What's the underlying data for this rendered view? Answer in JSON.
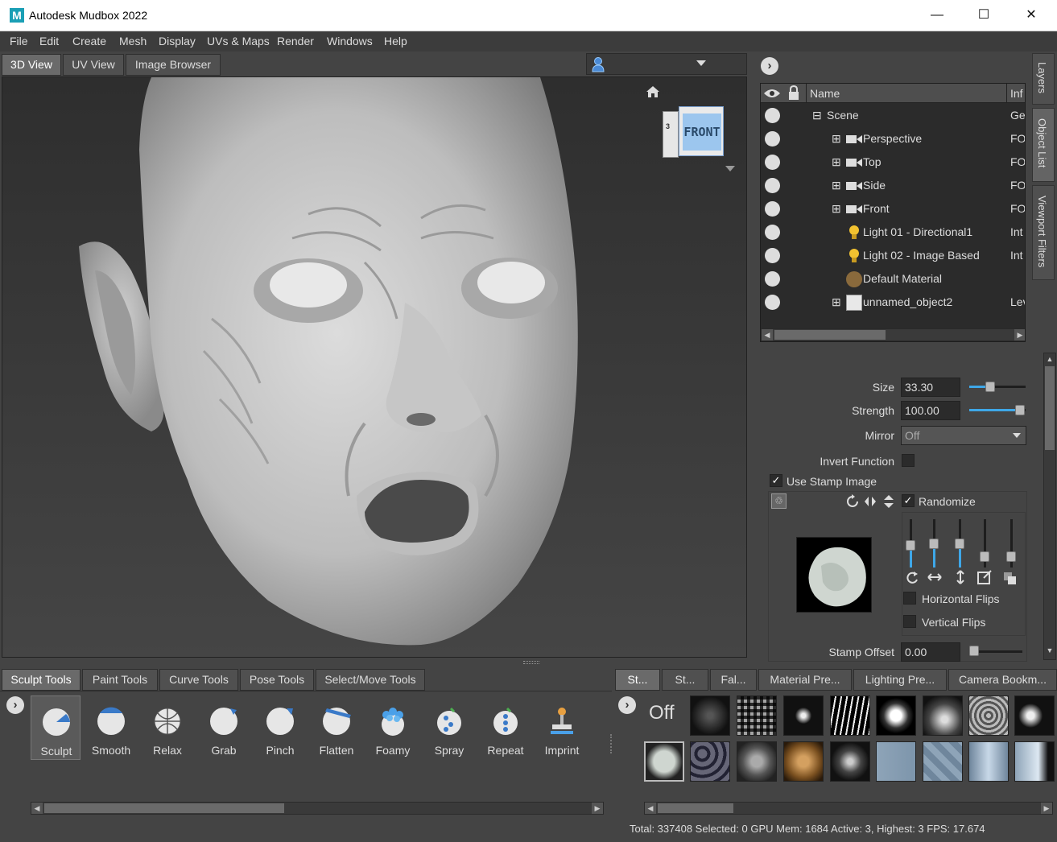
{
  "window": {
    "title": "Autodesk Mudbox 2022",
    "logo_letter": "M",
    "minimize": "—",
    "maximize": "☐",
    "close": "✕"
  },
  "menu": [
    "File",
    "Edit",
    "Create",
    "Mesh",
    "Display",
    "UVs & Maps",
    "Render",
    "Windows",
    "Help"
  ],
  "view_tabs": [
    {
      "label": "3D View",
      "active": true
    },
    {
      "label": "UV View",
      "active": false
    },
    {
      "label": "Image Browser",
      "active": false
    }
  ],
  "viewcube": {
    "face_label": "FRONT",
    "side_label": "3"
  },
  "object_list": {
    "columns": {
      "name": "Name",
      "info": "Inf"
    },
    "rows": [
      {
        "name": "Scene",
        "info": "Ge",
        "icon": "scene-node-icon",
        "expander": "⊟"
      },
      {
        "name": "Perspective",
        "info": "FO",
        "icon": "camera-icon",
        "expander": "⊞"
      },
      {
        "name": "Top",
        "info": "FO",
        "icon": "camera-icon",
        "expander": "⊞"
      },
      {
        "name": "Side",
        "info": "FO",
        "icon": "camera-icon",
        "expander": "⊞"
      },
      {
        "name": "Front",
        "info": "FO",
        "icon": "camera-icon",
        "expander": "⊞"
      },
      {
        "name": "Light 01 - Directional1",
        "info": "Int",
        "icon": "light-bulb-icon",
        "expander": ""
      },
      {
        "name": "Light 02 - Image Based",
        "info": "Int",
        "icon": "light-bulb-icon",
        "expander": ""
      },
      {
        "name": "Default Material",
        "info": "",
        "icon": "material-sphere-icon",
        "expander": ""
      },
      {
        "name": "unnamed_object2",
        "info": "Lev",
        "icon": "mesh-cube-icon",
        "expander": "⊞"
      }
    ]
  },
  "side_tabs": [
    "Layers",
    "Object List",
    "Viewport Filters"
  ],
  "properties": {
    "size_label": "Size",
    "size_value": "33.30",
    "size_fraction": 0.33,
    "strength_label": "Strength",
    "strength_value": "100.00",
    "strength_fraction": 1.0,
    "mirror_label": "Mirror",
    "mirror_value": "Off",
    "invert_label": "Invert Function",
    "invert_checked": false,
    "use_stamp_label": "Use Stamp Image",
    "use_stamp_checked": true,
    "randomize_label": "Randomize",
    "randomize_checked": true,
    "horizontal_flips_label": "Horizontal Flips",
    "horizontal_flips_checked": false,
    "vertical_flips_label": "Vertical Flips",
    "vertical_flips_checked": false,
    "stamp_offset_label": "Stamp Offset",
    "stamp_offset_value": "0.00"
  },
  "tool_tabs": [
    {
      "label": "Sculpt Tools",
      "active": true
    },
    {
      "label": "Paint Tools",
      "active": false
    },
    {
      "label": "Curve Tools",
      "active": false
    },
    {
      "label": "Pose Tools",
      "active": false
    },
    {
      "label": "Select/Move Tools",
      "active": false
    }
  ],
  "tools": [
    "Sculpt",
    "Smooth",
    "Relax",
    "Grab",
    "Pinch",
    "Flatten",
    "Foamy",
    "Spray",
    "Repeat",
    "Imprint"
  ],
  "tray_tabs": [
    "St...",
    "St...",
    "Fal...",
    "Material Pre...",
    "Lighting Pre...",
    "Camera Bookm..."
  ],
  "stamp_off_label": "Off",
  "status": "Total: 337408  Selected: 0 GPU Mem: 1684  Active: 3, Highest: 3  FPS: 17.674"
}
